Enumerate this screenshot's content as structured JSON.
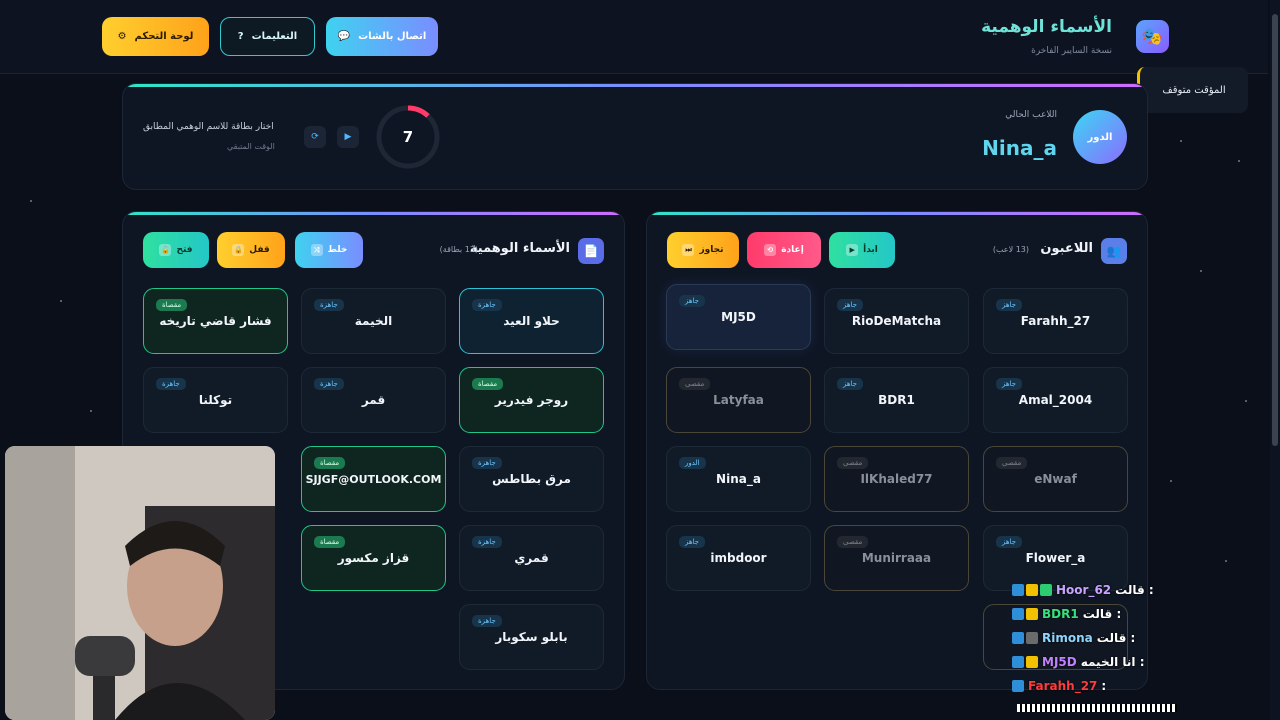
{
  "header": {
    "brand_title": "الأسماء الوهمية",
    "brand_subtitle": "نسخة السايبر الفاخرة",
    "buttons": {
      "dashboard": "لوحة التحكم",
      "instructions": "التعليمات",
      "chat_connect": "اتصال بالشات"
    }
  },
  "timer_toast": "المؤقت متوقف",
  "turn_bar": {
    "turn_label": "الدور",
    "current_player_label": "اللاعب الحالي",
    "current_player": "Nina_a",
    "timer_value": "7",
    "hint": "اختار بطاقة للاسم الوهمي المطابق",
    "time_left_label": "الوقت المتبقي"
  },
  "players_panel": {
    "title": "اللاعبون",
    "count": "(13 لاعب)",
    "buttons": {
      "start": "ابدأ",
      "restart": "إعادة",
      "skip": "تجاوز"
    },
    "players": [
      {
        "name": "Farahh_27",
        "badge": "جاهز",
        "state": "normal"
      },
      {
        "name": "RioDeMatcha",
        "badge": "جاهز",
        "state": "normal"
      },
      {
        "name": "MJ5D",
        "badge": "جاهز",
        "state": "active"
      },
      {
        "name": "Amal_2004",
        "badge": "جاهز",
        "state": "normal"
      },
      {
        "name": "BDR1",
        "badge": "جاهز",
        "state": "normal"
      },
      {
        "name": "Latyfaa",
        "badge": "مقصى",
        "state": "excluded"
      },
      {
        "name": "eNwaf",
        "badge": "مقصى",
        "state": "excluded"
      },
      {
        "name": "IlKhaled77",
        "badge": "مقصى",
        "state": "excluded"
      },
      {
        "name": "Nina_a",
        "badge": "الدور",
        "state": "normal"
      },
      {
        "name": "Flower_a",
        "badge": "جاهز",
        "state": "normal"
      },
      {
        "name": "Munirraaa",
        "badge": "مقصى",
        "state": "excluded"
      },
      {
        "name": "imbdoor",
        "badge": "جاهز",
        "state": "normal"
      }
    ]
  },
  "cards_panel": {
    "title": "الأسماء الوهمية",
    "count": "(13 بطاقة)",
    "buttons": {
      "shuffle": "خلط",
      "lock": "قفل",
      "open": "فتح"
    },
    "cards": [
      {
        "name": "حلاو العيد",
        "badge": "جاهزة",
        "state": "cyan"
      },
      {
        "name": "الخيمة",
        "badge": "جاهزة",
        "state": "normal"
      },
      {
        "name": "فشار قاضي تاريخه",
        "badge": "مقصاة",
        "state": "green"
      },
      {
        "name": "روجر فيدرير",
        "badge": "مقصاة",
        "state": "green"
      },
      {
        "name": "قمر",
        "badge": "جاهزة",
        "state": "normal"
      },
      {
        "name": "توكلنا",
        "badge": "جاهزة",
        "state": "normal"
      },
      {
        "name": "مرق بطاطس",
        "badge": "جاهزة",
        "state": "normal"
      },
      {
        "name": "SJJGF@OUTLOOK.COM",
        "badge": "مقصاة",
        "state": "green"
      },
      {
        "name": "قمري",
        "badge": "جاهزة",
        "state": "normal"
      },
      {
        "name": "قزاز مكسور",
        "badge": "مقصاة",
        "state": "green"
      },
      {
        "name": "بابلو سكوبار",
        "badge": "جاهزة",
        "state": "normal"
      }
    ]
  },
  "chat": [
    {
      "user": "Hoor_62",
      "user_color": "#c9a4ff",
      "msg": "قالت :"
    },
    {
      "user": "BDR1",
      "user_color": "#36e07e",
      "msg": "قالت :"
    },
    {
      "user": "Rimona",
      "user_color": "#8fd6ff",
      "msg": "قالت :"
    },
    {
      "user": "MJ5D",
      "user_color": "#c083ff",
      "msg": "انا الخيمه :"
    },
    {
      "user": "Farahh_27",
      "user_color": "#ff3b3b",
      "msg": ":"
    }
  ]
}
